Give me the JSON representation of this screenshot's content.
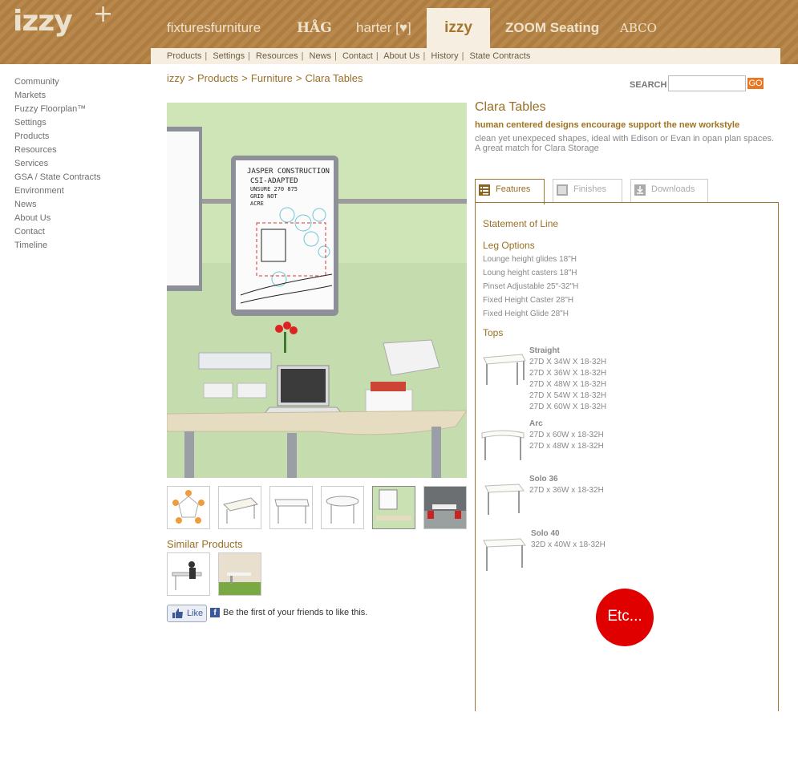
{
  "header": {
    "logo": "izzy",
    "logo_plus": "+",
    "brands": [
      "fixturesfurniture",
      "HÅG",
      "harter [♥]",
      "izzy",
      "ZOOM Seating",
      "ABCO"
    ],
    "subnav": [
      "Products",
      "Settings",
      "Resources",
      "News",
      "Contact",
      "About Us",
      "History",
      "State Contracts"
    ]
  },
  "leftnav": [
    "Community",
    "Markets",
    "Fuzzy Floorplan™",
    "Settings",
    "Products",
    "Resources",
    "Services",
    "GSA / State Contracts",
    "Environment",
    "News",
    "About Us",
    "Contact",
    "Timeline"
  ],
  "breadcrumb": [
    "izzy",
    "Products",
    "Furniture",
    "Clara Tables"
  ],
  "breadcrumb_sep": ">",
  "search": {
    "label": "SEARCH",
    "value": "",
    "button": "GO"
  },
  "hero_note": {
    "line1": "JASPER CONSTRUCTION",
    "line2": "CSI-ADAPTED",
    "line3": "UNSURE 270 875",
    "line4": "GRID NOT",
    "line5": "ACRE"
  },
  "similar_title": "Similar Products",
  "like": {
    "button": "Like",
    "text": "Be the first of your friends to like this.",
    "fb": "f"
  },
  "product": {
    "title": "Clara Tables",
    "tagline": "human centered designs encourage support the new workstyle",
    "description": "clean yet unexpeced shapes, ideal with Edison or Evan in opan plan spaces. A great match for Clara Storage"
  },
  "tabs": [
    "Features",
    "Finishes",
    "Downloads"
  ],
  "features": {
    "statement": "Statement of Line",
    "leg_title": "Leg Options",
    "legs": [
      "Lounge height glides 18\"H",
      "Loung height casters 18\"H",
      "Pinset Adjustable 25\"-32\"H",
      "Fixed Height Caster 28\"H",
      "Fixed Height Glide 28\"H"
    ],
    "tops_title": "Tops",
    "tops": [
      {
        "name": "Straight",
        "sizes": [
          "27D X 34W X 18-32H",
          "27D X 36W X 18-32H",
          "27D X 48W X 18-32H",
          "27D X 54W X 18-32H",
          "27D X 60W X 18-32H"
        ]
      },
      {
        "name": "Arc",
        "sizes": [
          "27D x 60W x 18-32H",
          "27D x 48W x 18-32H"
        ]
      },
      {
        "name": "Solo 36",
        "sizes": [
          "27D x 36W x 18-32H"
        ]
      },
      {
        "name": "Solo 40",
        "sizes": [
          "32D x 40W x 18-32H"
        ]
      }
    ],
    "etc": "Etc..."
  },
  "colors": {
    "accent": "#9b6f25",
    "header": "#b9884c",
    "go": "#e87722",
    "etc": "#e00000"
  }
}
